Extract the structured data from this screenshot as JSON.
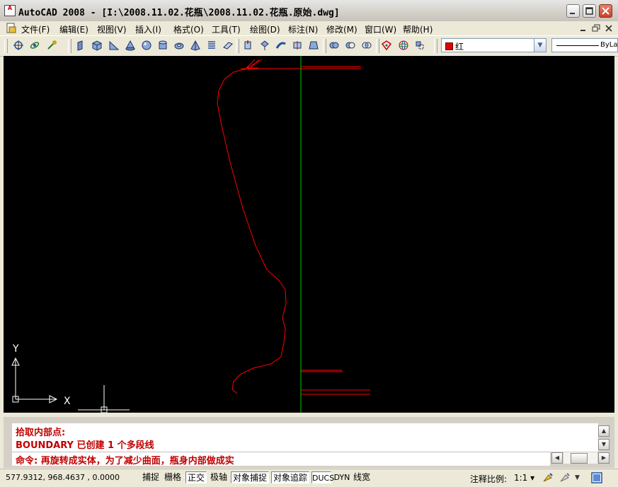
{
  "window": {
    "title": "AutoCAD 2008 - [I:\\2008.11.02.花瓶\\2008.11.02.花瓶.原始.dwg]",
    "app_icon_text": "A"
  },
  "menu": {
    "items": [
      {
        "label": "文件(F)"
      },
      {
        "label": "编辑(E)"
      },
      {
        "label": "视图(V)"
      },
      {
        "label": "插入(I)"
      },
      {
        "label": "格式(O)"
      },
      {
        "label": "工具(T)"
      },
      {
        "label": "绘图(D)"
      },
      {
        "label": "标注(N)"
      },
      {
        "label": "修改(M)"
      },
      {
        "label": "窗口(W)"
      },
      {
        "label": "帮助(H)"
      }
    ]
  },
  "toolbar": {
    "color_value": "红",
    "color_hex": "#e00000",
    "linetype_value": "ByLayer"
  },
  "canvas": {
    "ucs_y_label": "Y",
    "ucs_x_label": "X",
    "profile_color": "#ff0000",
    "axis_color": "#00c800"
  },
  "command": {
    "history": [
      "拾取内部点:",
      "BOUNDARY 已创建 1 个多段线"
    ],
    "current": "命令: 再旋转成实体，为了减少曲面，瓶身内部做成实"
  },
  "status": {
    "coordinates": "577.9312,  968.4637 ,  0.0000",
    "buttons": [
      {
        "label": "捕捉",
        "on": false
      },
      {
        "label": "栅格",
        "on": false
      },
      {
        "label": "正交",
        "on": true
      },
      {
        "label": "极轴",
        "on": false
      },
      {
        "label": "对象捕捉",
        "on": true
      },
      {
        "label": "对象追踪",
        "on": true
      },
      {
        "label": "DUCS",
        "on": true
      },
      {
        "label": "DYN",
        "on": false
      },
      {
        "label": "线宽",
        "on": false
      }
    ],
    "annotation_scale_label": "注释比例:",
    "annotation_scale_value": "1:1 ▾"
  }
}
